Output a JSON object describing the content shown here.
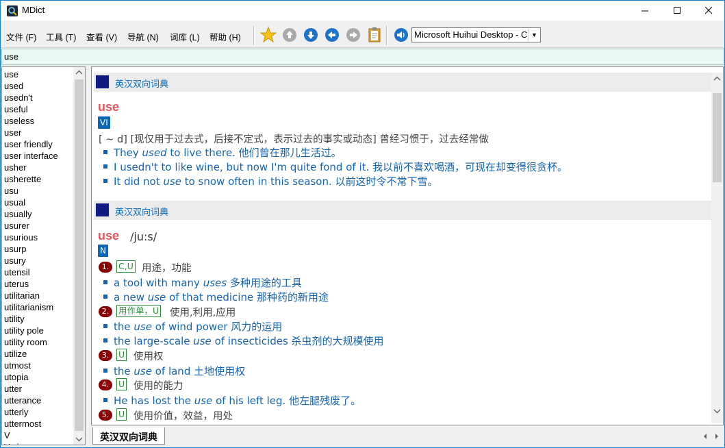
{
  "window": {
    "title": "MDict"
  },
  "menubar": {
    "items": [
      "文件 (F)",
      "工具 (T)",
      "查看 (V)",
      "导航 (N)",
      "词库 (L)",
      "帮助 (H)"
    ]
  },
  "toolbar": {
    "icons": [
      "favorite-star-icon",
      "up-arrow-icon",
      "down-arrow-icon",
      "back-arrow-icon",
      "forward-arrow-icon",
      "clipboard-icon",
      "speaker-icon"
    ],
    "voice": "Microsoft Huihui Desktop - C"
  },
  "search": {
    "value": "use"
  },
  "wordlist": {
    "items": [
      "use",
      "used",
      "usedn't",
      "useful",
      "useless",
      "user",
      "user friendly",
      "user interface",
      "usher",
      "usherette",
      "usu",
      "usual",
      "usually",
      "usurer",
      "usurious",
      "usurp",
      "usury",
      "utensil",
      "uterus",
      "utilitarian",
      "utilitarianism",
      "utility",
      "utility pole",
      "utility room",
      "utilize",
      "utmost",
      "utopia",
      "utter",
      "utterance",
      "utterly",
      "uttermost",
      "V",
      "V-sign"
    ]
  },
  "entries": [
    {
      "dict_name": "英汉双向词典",
      "headword": "use",
      "pos": "VI",
      "definition": "[ ~ d] [现仅用于过去式，后接不定式，表示过去的事实或动态] 曾经习惯于，过去经常做",
      "examples": [
        {
          "pre": "They ",
          "italic": "used",
          "post": " to live there. 他们曾在那儿生活过。"
        },
        {
          "pre": "I usedn't to like wine, but now I'm quite fond of it. 我以前不喜欢喝酒，可现在却变得很贪杯。",
          "italic": "",
          "post": ""
        },
        {
          "pre": "It did not ",
          "italic": "use",
          "post": " to snow often in this season. 以前这时令不常下雪。"
        }
      ]
    },
    {
      "dict_name": "英汉双向词典",
      "headword": "use",
      "phonetic": "/ju:s/",
      "pos": "N",
      "senses": [
        {
          "num": "1.",
          "gram": "C,U",
          "def": "用途，功能",
          "examples": [
            {
              "pre": "a tool with many ",
              "italic": "uses",
              "post": " 多种用途的工具"
            },
            {
              "pre": "a new ",
              "italic": "use",
              "post": " of that medicine 那种药的新用途"
            }
          ]
        },
        {
          "num": "2.",
          "gram": "用作单，U",
          "def": "使用,利用,应用",
          "examples": [
            {
              "pre": "the ",
              "italic": "use",
              "post": " of wind power 风力的运用"
            },
            {
              "pre": "the large-scale ",
              "italic": "use",
              "post": " of insecticides 杀虫剂的大规模使用"
            }
          ]
        },
        {
          "num": "3.",
          "gram": "U",
          "def": "使用权",
          "examples": [
            {
              "pre": "the ",
              "italic": "use",
              "post": " of land 土地使用权"
            }
          ]
        },
        {
          "num": "4.",
          "gram": "U",
          "def": "使用的能力",
          "examples": [
            {
              "pre": "He has lost the ",
              "italic": "use",
              "post": " of his left leg. 他左腿残废了。"
            }
          ]
        },
        {
          "num": "5.",
          "gram": "U",
          "def": "使用价值，效益，用处",
          "examples": []
        }
      ]
    }
  ],
  "tabs": {
    "active": "英汉双向词典"
  }
}
